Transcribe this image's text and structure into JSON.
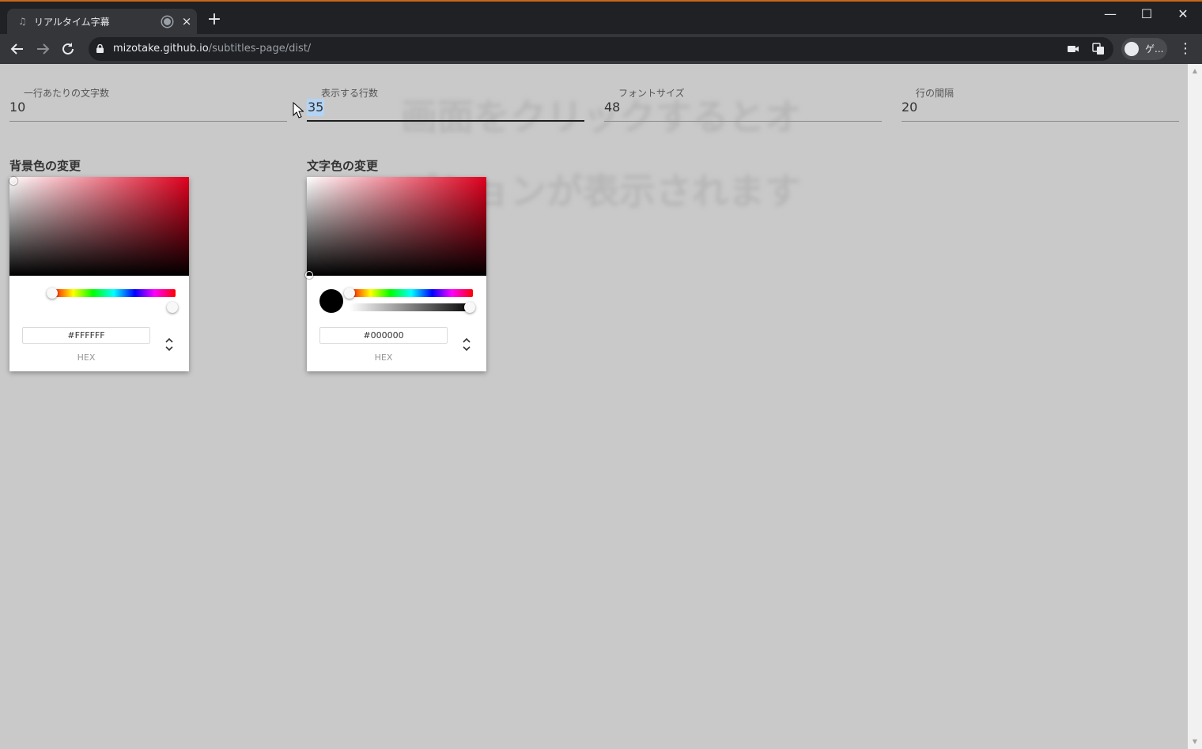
{
  "browser": {
    "tab_title": "リアルタイム字幕",
    "tab_close": "×",
    "new_tab": "+",
    "url_host": "mizotake.github.io",
    "url_path": "/subtitles-page/dist/",
    "profile_name": "ゲ...",
    "window": {
      "minimize": "—",
      "maximize": "☐",
      "close": "✕"
    }
  },
  "background_text": "画面をクリックするとオプションが表示されます",
  "settings": {
    "fields": [
      {
        "label": "一行あたりの文字数",
        "value": "10"
      },
      {
        "label": "表示する行数",
        "value": "35"
      },
      {
        "label": "フォントサイズ",
        "value": "48"
      },
      {
        "label": "行の間隔",
        "value": "20"
      }
    ],
    "background_color": {
      "title": "背景色の変更",
      "hex": "#FFFFFF",
      "format_label": "HEX",
      "hue_color": "#e0001e",
      "current_color": "#ffffff"
    },
    "text_color": {
      "title": "文字色の変更",
      "hex": "#000000",
      "format_label": "HEX",
      "hue_color": "#e0001e",
      "current_color": "#000000"
    }
  },
  "colors": {
    "chrome_dark": "#202124",
    "chrome_tab": "#35363a",
    "page_bg": "#c9c9c9",
    "accent_border": "#c8661a"
  }
}
